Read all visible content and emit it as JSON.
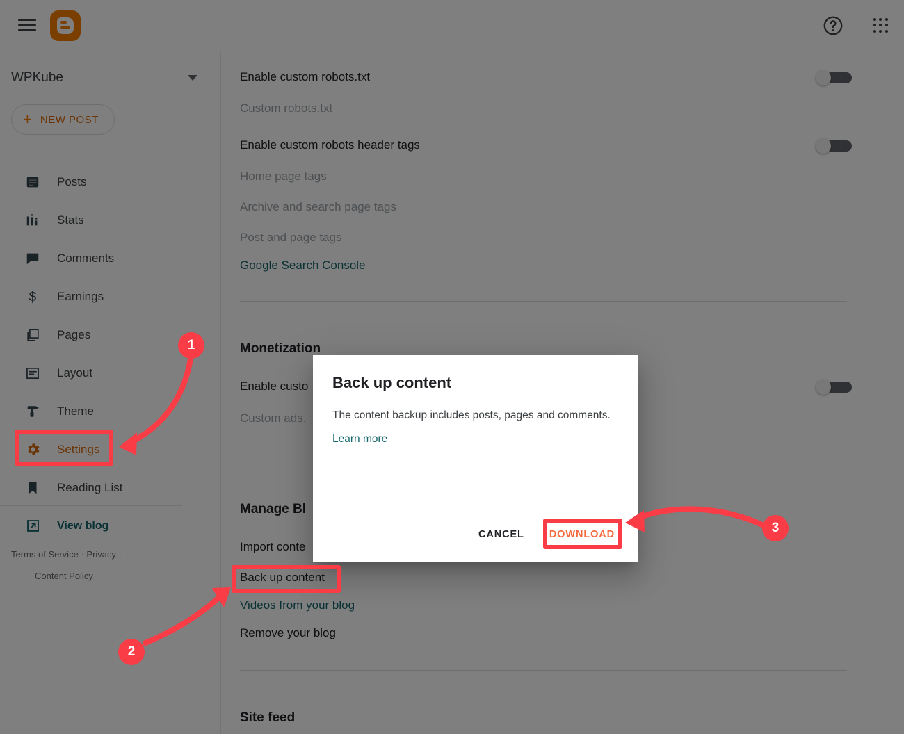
{
  "header": {
    "menu_icon": "hamburger-menu-icon",
    "logo": "blogger-logo",
    "help_icon": "help-circle-icon",
    "apps_icon": "apps-grid-icon"
  },
  "sidebar": {
    "blog_name": "WPKube",
    "new_post_label": "NEW POST",
    "items": [
      {
        "label": "Posts",
        "icon": "posts-icon"
      },
      {
        "label": "Stats",
        "icon": "stats-icon"
      },
      {
        "label": "Comments",
        "icon": "comments-icon"
      },
      {
        "label": "Earnings",
        "icon": "earnings-icon"
      },
      {
        "label": "Pages",
        "icon": "pages-icon"
      },
      {
        "label": "Layout",
        "icon": "layout-icon"
      },
      {
        "label": "Theme",
        "icon": "theme-icon"
      },
      {
        "label": "Settings",
        "icon": "settings-gear-icon"
      },
      {
        "label": "Reading List",
        "icon": "reading-list-icon"
      }
    ],
    "view_blog_label": "View blog",
    "view_blog_icon": "external-link-icon",
    "legal": {
      "terms": "Terms of Service",
      "sep1": "·",
      "privacy": "Privacy",
      "sep2": "·",
      "content_policy": "Content Policy"
    }
  },
  "main": {
    "rows": {
      "enable_custom_robots_txt": "Enable custom robots.txt",
      "custom_robots_txt": "Custom robots.txt",
      "enable_custom_robots_header_tags": "Enable custom robots header tags",
      "home_page_tags": "Home page tags",
      "archive_and_search_page_tags": "Archive and search page tags",
      "post_and_page_tags": "Post and page tags",
      "google_search_console": "Google Search Console",
      "monetization_title": "Monetization",
      "enable_custom_ads_txt": "Enable custo",
      "custom_ads_txt": "Custom ads.",
      "manage_blog_title": "Manage Bl",
      "import_content": "Import conte",
      "back_up_content": "Back up content",
      "videos_from_your_blog": "Videos from your blog",
      "remove_your_blog": "Remove your blog",
      "site_feed_title": "Site feed"
    },
    "toggles": {
      "robots_txt_state": "off",
      "robots_header_tags_state": "off",
      "custom_ads_state": "off"
    }
  },
  "dialog": {
    "title": "Back up content",
    "body": "The content backup includes posts, pages and comments.",
    "learn_more": "Learn more",
    "cancel_label": "CANCEL",
    "download_label": "DOWNLOAD"
  },
  "annotations": {
    "badges": [
      {
        "number": "1"
      },
      {
        "number": "2"
      },
      {
        "number": "3"
      }
    ],
    "accent_color": "#fa3c46"
  }
}
